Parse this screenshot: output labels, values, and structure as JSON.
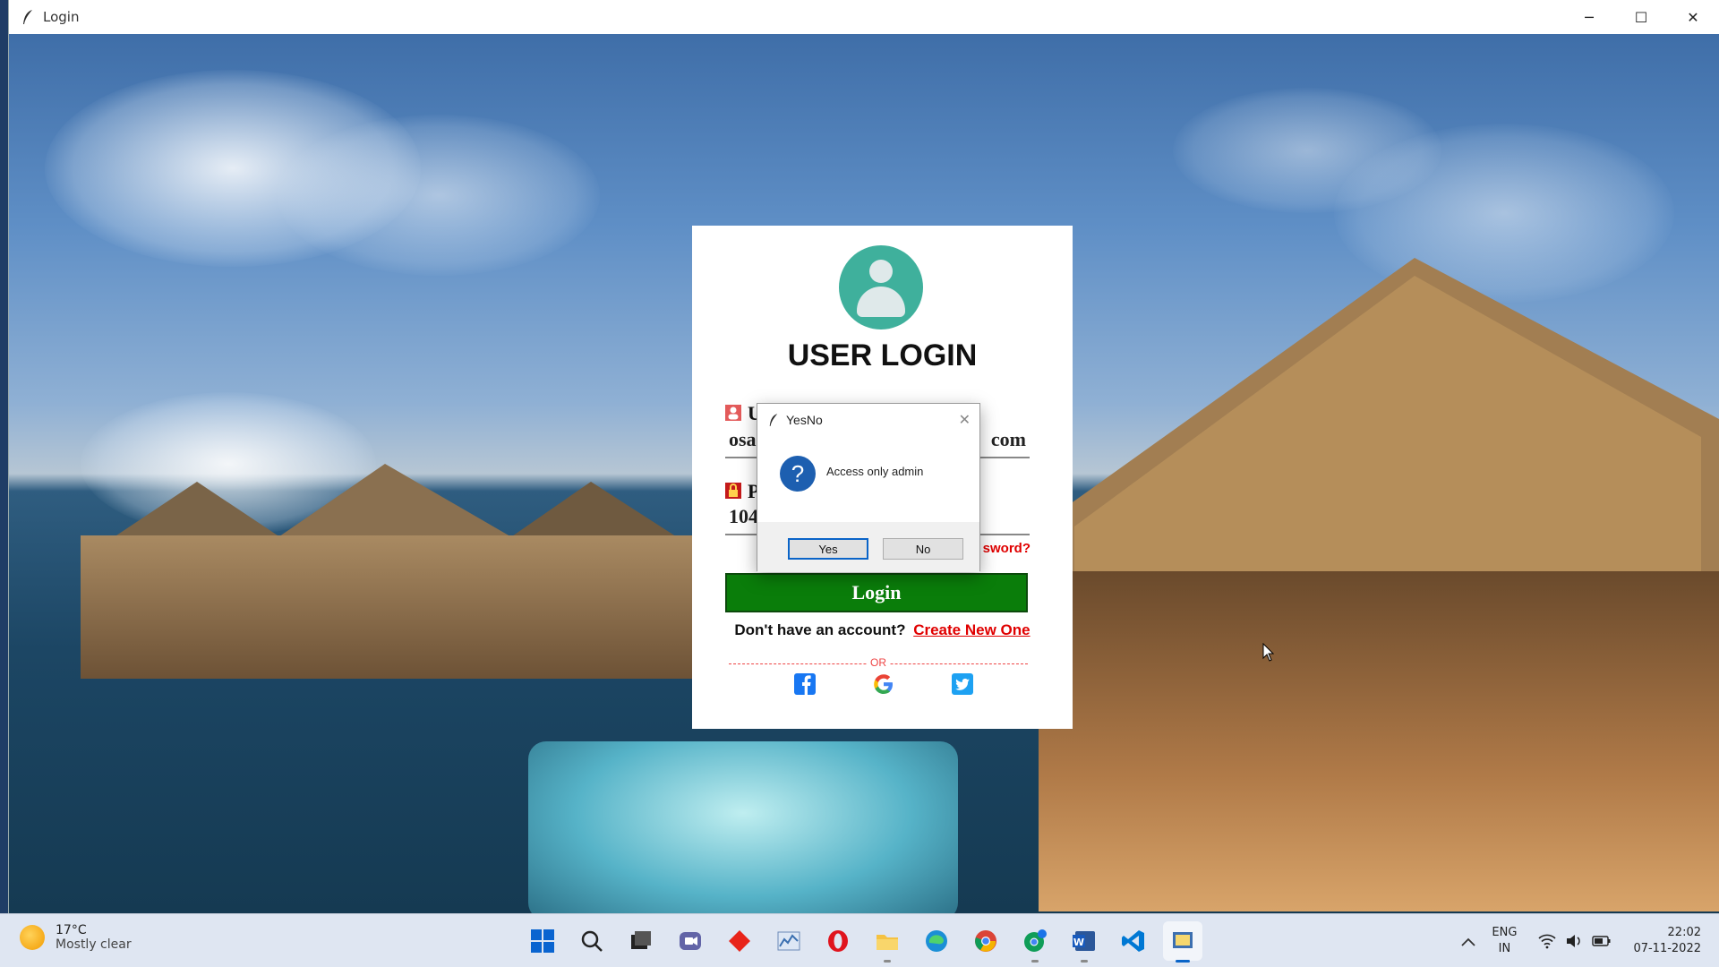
{
  "window": {
    "title": "Login",
    "minimize": "─",
    "maximize": "☐",
    "close": "✕"
  },
  "card": {
    "title": "USER LOGIN",
    "username_value": "osa",
    "username_tail": "com",
    "username_label": "U",
    "password_value": "104",
    "password_label": "P",
    "forgot_label": "sword?",
    "login_label": "Login",
    "signup_text": "Don't have an account?",
    "signup_link": "Create New One",
    "or_text": "OR"
  },
  "dialog": {
    "title": "YesNo",
    "close": "✕",
    "icon": "question-icon",
    "icon_glyph": "?",
    "message": "Access only admin",
    "yes_label": "Yes",
    "no_label": "No"
  },
  "taskbar": {
    "weather_temp": "17°C",
    "weather_desc": "Mostly clear",
    "apps": [
      "start",
      "search",
      "task-view",
      "teams-chat",
      "diamond-app",
      "stock-app",
      "opera",
      "file-explorer",
      "edge",
      "chrome",
      "chrome-profile",
      "word",
      "vscode",
      "python-app"
    ],
    "lang_line1": "ENG",
    "lang_line2": "IN",
    "time": "22:02",
    "date": "07-11-2022",
    "chevron": "^"
  },
  "colors": {
    "login_green": "#0a7d0a",
    "accent_red": "#e00000",
    "avatar_teal": "#3fb09c",
    "dialog_blue": "#1d5fb0"
  }
}
